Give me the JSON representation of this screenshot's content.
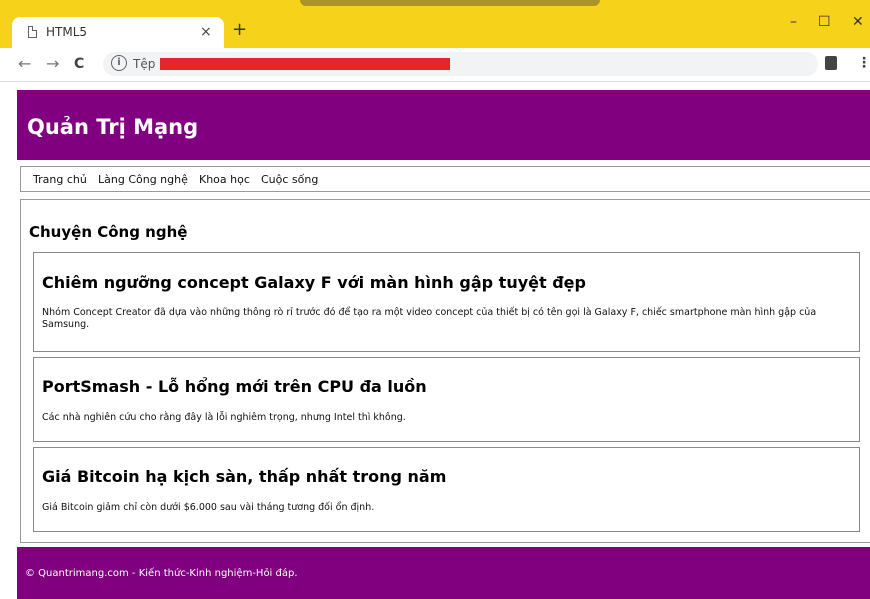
{
  "browser": {
    "tab_title": "HTML5",
    "tab_close": "×",
    "new_tab": "+",
    "window_minimize": "–",
    "window_maximize": "☐",
    "window_close": "✕",
    "back": "←",
    "forward": "→",
    "reload": "C",
    "url_scheme_label": "Tệp",
    "info_glyph": "i",
    "menu_glyph": "⋮"
  },
  "site": {
    "title": "Quản Trị Mạng",
    "nav": [
      "Trang chủ",
      "Làng Công nghệ",
      "Khoa học",
      "Cuộc sống"
    ],
    "section_title": "Chuyện Công nghệ",
    "articles": [
      {
        "title": "Chiêm ngưỡng concept Galaxy F với màn hình gập tuyệt đẹp",
        "body": "Nhóm Concept Creator đã dựa vào những thông rò rỉ trước đó để tạo ra một video concept của thiết bị có tên gọi là Galaxy F, chiếc smartphone màn hình gập của Samsung."
      },
      {
        "title": "PortSmash - Lỗ hổng mới trên CPU đa luồn",
        "body": "Các nhà nghiên cứu cho rằng đây là lỗi nghiêm trọng, nhưng Intel thì không."
      },
      {
        "title": "Giá Bitcoin hạ kịch sàn, thấp nhất trong năm",
        "body": "Giá Bitcoin giảm chỉ còn dưới $6.000 sau vài tháng tương đối ổn định."
      }
    ],
    "footer": "© Quantrimang.com - Kiến thức-Kinh nghiệm-Hỏi đáp."
  },
  "colors": {
    "brand": "#800080",
    "titlebar": "#f6d31a",
    "redaction": "#e5262b"
  }
}
